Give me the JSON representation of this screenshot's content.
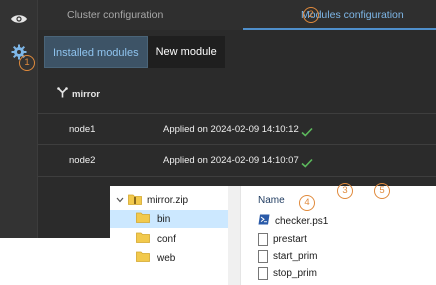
{
  "sidebar": {
    "items": [
      {
        "icon": "eye-icon"
      },
      {
        "icon": "gear-icon"
      }
    ]
  },
  "top_tabs": [
    {
      "label": "Cluster configuration"
    },
    {
      "label": "Modules configuration"
    }
  ],
  "sub_tabs": [
    {
      "label": "Installed modules"
    },
    {
      "label": "New module"
    }
  ],
  "module": {
    "name": "mirror",
    "icon": "fork-icon"
  },
  "nodes": [
    {
      "name": "node1",
      "status": "Applied on 2024-02-09 14:10:12"
    },
    {
      "name": "node2",
      "status": "Applied on 2024-02-09 14:10:07"
    }
  ],
  "actions": [
    {
      "icon": "download-icon"
    },
    {
      "icon": "upload-icon"
    },
    {
      "icon": "history-icon"
    }
  ],
  "badges": [
    "1",
    "2",
    "3",
    "4",
    "5"
  ],
  "explorer": {
    "tree": {
      "zip": "mirror.zip",
      "folders": [
        "bin",
        "conf",
        "web"
      ]
    },
    "column_header": "Name",
    "files": [
      "checker.ps1",
      "prestart",
      "start_prim",
      "stop_prim"
    ]
  },
  "colors": {
    "accent": "#7eb7e8",
    "badge": "#e08a3c",
    "check": "#5cb85c",
    "sidebar": "#333333",
    "panel": "#2b2b2b"
  }
}
